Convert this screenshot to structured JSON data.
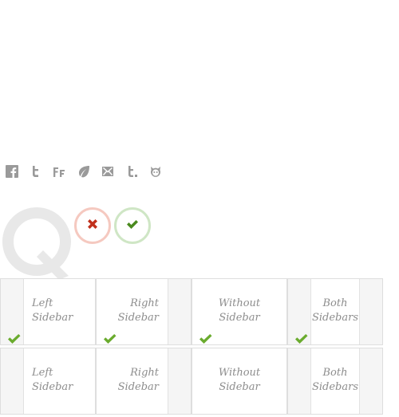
{
  "social_icons": [
    {
      "name": "facebook-icon",
      "glyph": "f"
    },
    {
      "name": "twitter-icon",
      "glyph": "t"
    },
    {
      "name": "friendfeed-icon",
      "glyph": "ff"
    },
    {
      "name": "leaf-icon",
      "glyph": "leaf"
    },
    {
      "name": "email-icon",
      "glyph": "envelope"
    },
    {
      "name": "tumblr-icon",
      "glyph": "t."
    },
    {
      "name": "mascot-icon",
      "glyph": "face"
    }
  ],
  "colors": {
    "icon_gray": "#9a9a9a",
    "logo_gray": "#e8e8e8",
    "reject_red": "#c0301c",
    "accept_green": "#4a8a1e",
    "check_green": "#6aab2e",
    "label_gray": "#8d8d8d"
  },
  "status_buttons": {
    "reject": {
      "icon": "close-icon"
    },
    "accept": {
      "icon": "checkmark-icon"
    }
  },
  "layouts": {
    "row1": {
      "left": {
        "line1": "Left",
        "line2": "Sidebar",
        "checked": true
      },
      "right": {
        "line1": "Right",
        "line2": "Sidebar",
        "checked": true
      },
      "none": {
        "line1": "Without",
        "line2": "Sidebar",
        "checked": true
      },
      "both": {
        "line1": "Both",
        "line2": "Sidebars",
        "checked": true
      }
    },
    "row2": {
      "left": {
        "line1": "Left",
        "line2": "Sidebar",
        "checked": false
      },
      "right": {
        "line1": "Right",
        "line2": "Sidebar",
        "checked": false
      },
      "none": {
        "line1": "Without",
        "line2": "Sidebar",
        "checked": false
      },
      "both": {
        "line1": "Both",
        "line2": "Sidebars",
        "checked": false
      }
    }
  }
}
